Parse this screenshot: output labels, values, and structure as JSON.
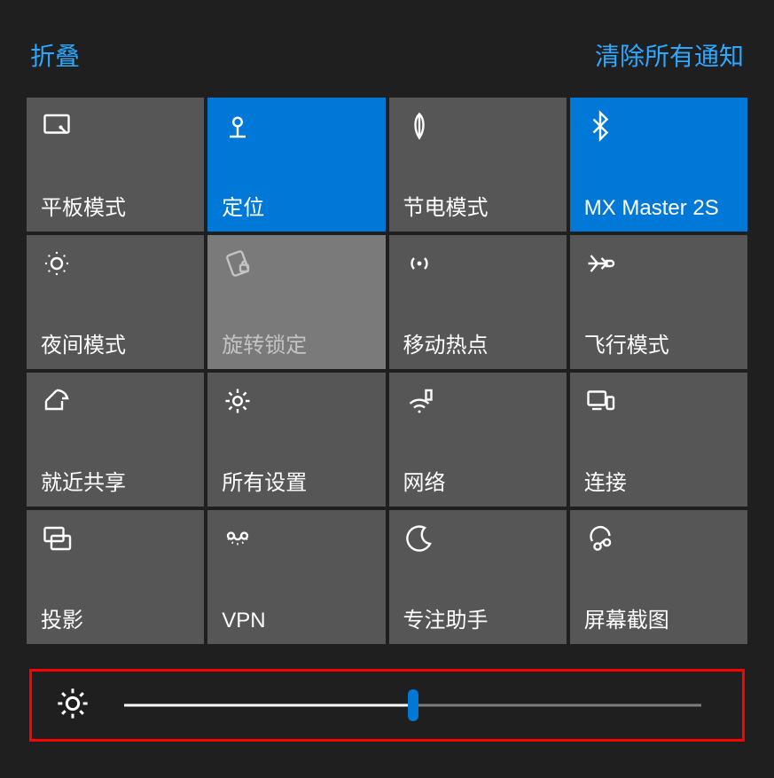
{
  "header": {
    "collapse": "折叠",
    "clear_all": "清除所有通知"
  },
  "tiles": [
    {
      "id": "tablet-mode",
      "label": "平板模式",
      "icon": "tablet-icon",
      "state": "off"
    },
    {
      "id": "location",
      "label": "定位",
      "icon": "location-pin-icon",
      "state": "on"
    },
    {
      "id": "battery-saver",
      "label": "节电模式",
      "icon": "leaf-icon",
      "state": "off"
    },
    {
      "id": "bluetooth",
      "label": "MX Master 2S",
      "icon": "bluetooth-icon",
      "state": "on"
    },
    {
      "id": "night-light",
      "label": "夜间模式",
      "icon": "sun-dim-icon",
      "state": "off"
    },
    {
      "id": "rotation-lock",
      "label": "旋转锁定",
      "icon": "rotation-lock-icon",
      "state": "disabled"
    },
    {
      "id": "mobile-hotspot",
      "label": "移动热点",
      "icon": "hotspot-icon",
      "state": "off"
    },
    {
      "id": "airplane-mode",
      "label": "飞行模式",
      "icon": "airplane-icon",
      "state": "off"
    },
    {
      "id": "nearby-sharing",
      "label": "就近共享",
      "icon": "share-icon",
      "state": "off"
    },
    {
      "id": "all-settings",
      "label": "所有设置",
      "icon": "gear-icon",
      "state": "off"
    },
    {
      "id": "network",
      "label": "网络",
      "icon": "wifi-tower-icon",
      "state": "off"
    },
    {
      "id": "connect",
      "label": "连接",
      "icon": "connect-icon",
      "state": "off"
    },
    {
      "id": "project",
      "label": "投影",
      "icon": "project-icon",
      "state": "off"
    },
    {
      "id": "vpn",
      "label": "VPN",
      "icon": "vpn-icon",
      "state": "off"
    },
    {
      "id": "focus-assist",
      "label": "专注助手",
      "icon": "moon-icon",
      "state": "off"
    },
    {
      "id": "screen-snip",
      "label": "屏幕截图",
      "icon": "snip-icon",
      "state": "off"
    }
  ],
  "brightness": {
    "value": 50,
    "min": 0,
    "max": 100
  },
  "colors": {
    "accent": "#0078d7",
    "link": "#2ea7ff"
  }
}
